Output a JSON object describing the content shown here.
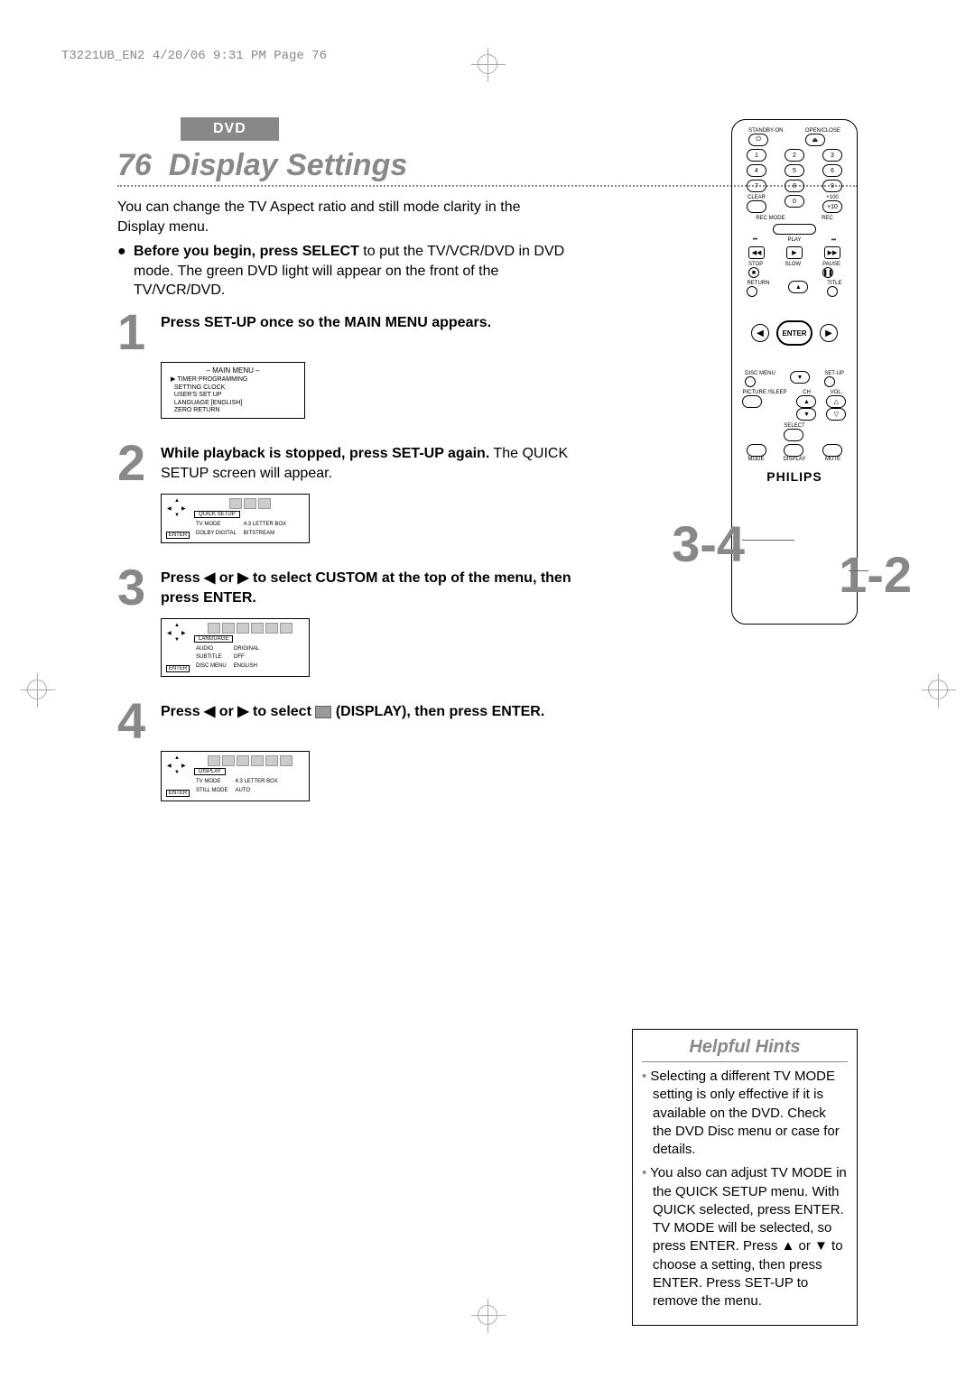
{
  "header_slug": "T3221UB_EN2  4/20/06  9:31 PM  Page 76",
  "section_tag": "DVD",
  "page_number": "76",
  "page_title": "Display Settings",
  "intro_line1": "You can change the TV Aspect ratio and still mode clarity in the Display menu.",
  "bullet_lead_bold": "Before you begin, press SELECT",
  "bullet_lead_rest": " to put the TV/VCR/DVD in DVD mode. The green DVD light will appear on the front of the TV/VCR/DVD.",
  "steps": {
    "s1": {
      "num": "1",
      "bold": "Press SET-UP once so the MAIN MENU appears.",
      "rest": ""
    },
    "s2": {
      "num": "2",
      "bold": "While playback is stopped, press SET-UP again.",
      "rest": " The QUICK SETUP screen will appear."
    },
    "s3": {
      "num": "3",
      "bold_a": "Press ",
      "arrows": "◀ or ▶",
      "bold_b": " to select CUSTOM at the top of the menu, then press ENTER."
    },
    "s4": {
      "num": "4",
      "bold_a": "Press ",
      "arrows": "◀ or ▶",
      "bold_b": " to select ",
      "bold_c": " (DISPLAY), then press ENTER."
    }
  },
  "main_menu": {
    "title": "– MAIN MENU –",
    "items": [
      "TIMER PROGRAMMING",
      "SETTING CLOCK",
      "USER'S SET UP",
      "LANGUAGE   [ENGLISH]",
      "ZERO RETURN"
    ]
  },
  "quick_setup_osd": {
    "tab": "QUICK SETUP",
    "row1_l": "TV MODE",
    "row1_r": "4:3 LETTER BOX",
    "row2_l": "DOLBY DIGITAL",
    "row2_r": "BITSTREAM",
    "enter": "ENTER"
  },
  "language_osd": {
    "tab": "LANGUAGE",
    "row1_l": "AUDIO",
    "row1_r": "ORIGINAL",
    "row2_l": "SUBTITLE",
    "row2_r": "OFF",
    "row3_l": "DISC MENU",
    "row3_r": "ENGLISH",
    "enter": "ENTER"
  },
  "display_osd": {
    "tab": "DISPLAY",
    "row1_l": "TV MODE",
    "row1_r": "4:3 LETTER BOX",
    "row2_l": "STILL MODE",
    "row2_r": "AUTO",
    "enter": "ENTER"
  },
  "callouts": {
    "left": "3-4",
    "right": "1-2"
  },
  "remote": {
    "standby": "STANDBY-ON",
    "openclose": "OPEN/CLOSE",
    "clear": "CLEAR",
    "plus100": "+100",
    "recmode": "REC MODE",
    "rec": "REC",
    "play": "PLAY",
    "stop": "STOP",
    "slow": "SLOW",
    "pause": "PAUSE",
    "return": "RETURN",
    "title": "TITLE",
    "enter": "ENTER",
    "disc": "DISC MENU",
    "setup": "SET-UP",
    "picture": "PICTURE /SLEEP",
    "ch": "CH",
    "vol": "VOL.",
    "select": "SELECT",
    "mode": "MODE",
    "display": "DISPLAY",
    "mute": "MUTE",
    "brand": "PHILIPS",
    "nums": [
      "1",
      "2",
      "3",
      "4",
      "5",
      "6",
      "7",
      "8",
      "9",
      "0",
      "+10"
    ]
  },
  "hints": {
    "title": "Helpful Hints",
    "items": [
      "Selecting a different TV MODE setting is only effective if it is available on the DVD. Check the DVD Disc menu or case for details.",
      "You also can adjust TV MODE in the QUICK SETUP menu. With QUICK selected, press ENTER.  TV MODE will be selected, so press ENTER. Press ▲ or ▼ to choose a setting, then press ENTER. Press SET-UP to remove the menu."
    ]
  }
}
